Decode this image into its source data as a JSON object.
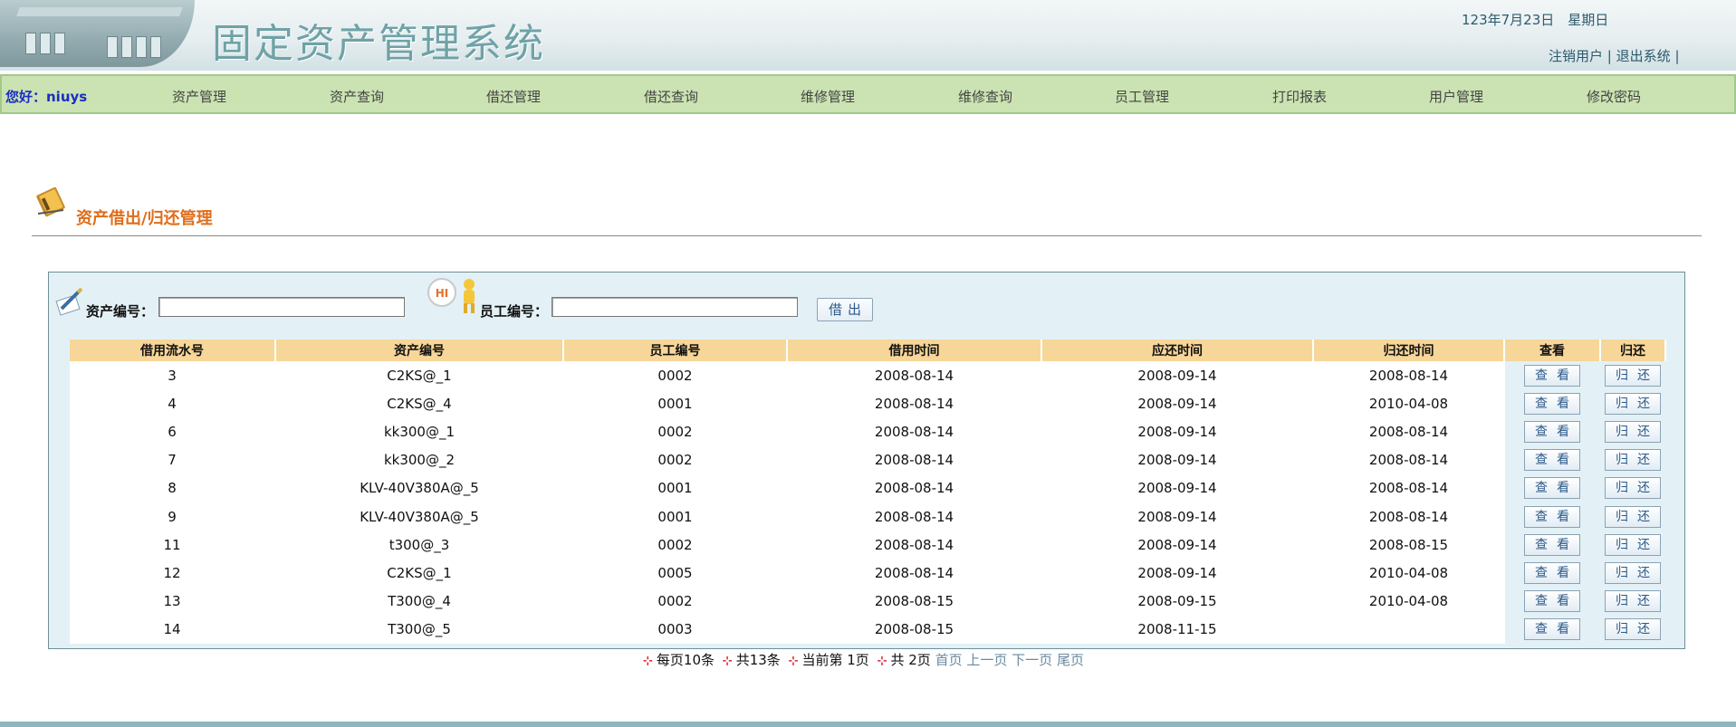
{
  "header": {
    "title": "固定资产管理系统",
    "date": "123年7月23日　星期日",
    "logout_user": "注销用户",
    "exit_system": "退出系统",
    "sep": "|"
  },
  "nav": {
    "greeting": "您好：niuys",
    "items": [
      "资产管理",
      "资产查询",
      "借还管理",
      "借还查询",
      "维修管理",
      "维修查询",
      "员工管理",
      "打印报表",
      "用户管理",
      "修改密码"
    ]
  },
  "page": {
    "title": "资产借出/归还管理"
  },
  "form": {
    "asset_label": "资产编号：",
    "asset_value": "",
    "employee_label": "员工编号：",
    "employee_value": "",
    "hi_text": "HI",
    "lend_button": "借出"
  },
  "table": {
    "headers": [
      "借用流水号",
      "资产编号",
      "员工编号",
      "借用时间",
      "应还时间",
      "归还时间",
      "查看",
      "归还"
    ],
    "view_label": "查看",
    "return_label": "归还",
    "rows": [
      {
        "id": "3",
        "asset": "C2KS@_1",
        "emp": "0002",
        "borrow": "2008-08-14",
        "due": "2008-09-14",
        "ret": "2008-08-14"
      },
      {
        "id": "4",
        "asset": "C2KS@_4",
        "emp": "0001",
        "borrow": "2008-08-14",
        "due": "2008-09-14",
        "ret": "2010-04-08"
      },
      {
        "id": "6",
        "asset": "kk300@_1",
        "emp": "0002",
        "borrow": "2008-08-14",
        "due": "2008-09-14",
        "ret": "2008-08-14"
      },
      {
        "id": "7",
        "asset": "kk300@_2",
        "emp": "0002",
        "borrow": "2008-08-14",
        "due": "2008-09-14",
        "ret": "2008-08-14"
      },
      {
        "id": "8",
        "asset": "KLV-40V380A@_5",
        "emp": "0001",
        "borrow": "2008-08-14",
        "due": "2008-09-14",
        "ret": "2008-08-14"
      },
      {
        "id": "9",
        "asset": "KLV-40V380A@_5",
        "emp": "0001",
        "borrow": "2008-08-14",
        "due": "2008-09-14",
        "ret": "2008-08-14"
      },
      {
        "id": "11",
        "asset": "t300@_3",
        "emp": "0002",
        "borrow": "2008-08-14",
        "due": "2008-09-14",
        "ret": "2008-08-15"
      },
      {
        "id": "12",
        "asset": "C2KS@_1",
        "emp": "0005",
        "borrow": "2008-08-14",
        "due": "2008-09-14",
        "ret": "2010-04-08"
      },
      {
        "id": "13",
        "asset": "T300@_4",
        "emp": "0002",
        "borrow": "2008-08-15",
        "due": "2008-09-15",
        "ret": "2010-04-08"
      },
      {
        "id": "14",
        "asset": "T300@_5",
        "emp": "0003",
        "borrow": "2008-08-15",
        "due": "2008-11-15",
        "ret": ""
      }
    ]
  },
  "pager": {
    "per_page": "每页10条",
    "total": "共13条",
    "current": "当前第 1页",
    "pages": "共 2页",
    "first": "首页",
    "prev": "上一页",
    "next": "下一页",
    "last": "尾页"
  },
  "colors": {
    "nav_bg": "#cbe3b2",
    "table_header_bg": "#f7d699",
    "panel_bg": "#e3f1f6",
    "title_orange": "#e06d1a",
    "greeting_blue": "#1a2ec5"
  }
}
